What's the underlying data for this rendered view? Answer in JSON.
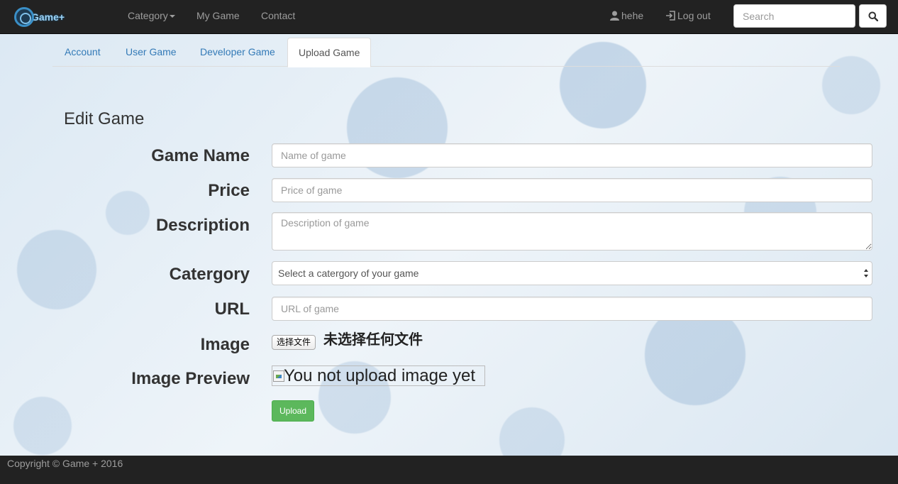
{
  "navbar": {
    "brand": "Game+",
    "links": {
      "category": "Category",
      "my_game": "My Game",
      "contact": "Contact"
    },
    "user": "hehe",
    "logout": "Log out",
    "search_placeholder": "Search"
  },
  "tabs": {
    "account": "Account",
    "user_game": "User Game",
    "developer_game": "Developer Game",
    "upload_game": "Upload Game",
    "active": "Upload Game"
  },
  "form": {
    "title": "Edit Game",
    "game_name": {
      "label": "Game Name",
      "placeholder": "Name of game"
    },
    "price": {
      "label": "Price",
      "placeholder": "Price of game"
    },
    "description": {
      "label": "Description",
      "placeholder": "Description of game"
    },
    "category": {
      "label": "Catergory",
      "selected": "Select a catergory of your game"
    },
    "url": {
      "label": "URL",
      "placeholder": "URL of game"
    },
    "image": {
      "label": "Image",
      "button": "选择文件",
      "status": "未选择任何文件"
    },
    "image_preview": {
      "label": "Image Preview",
      "alt": "You not upload image yet"
    },
    "submit": "Upload"
  },
  "footer": {
    "text": "Copyright © Game + 2016"
  },
  "colors": {
    "navbar": "#222222",
    "link": "#337ab7",
    "success": "#5cb85c"
  }
}
